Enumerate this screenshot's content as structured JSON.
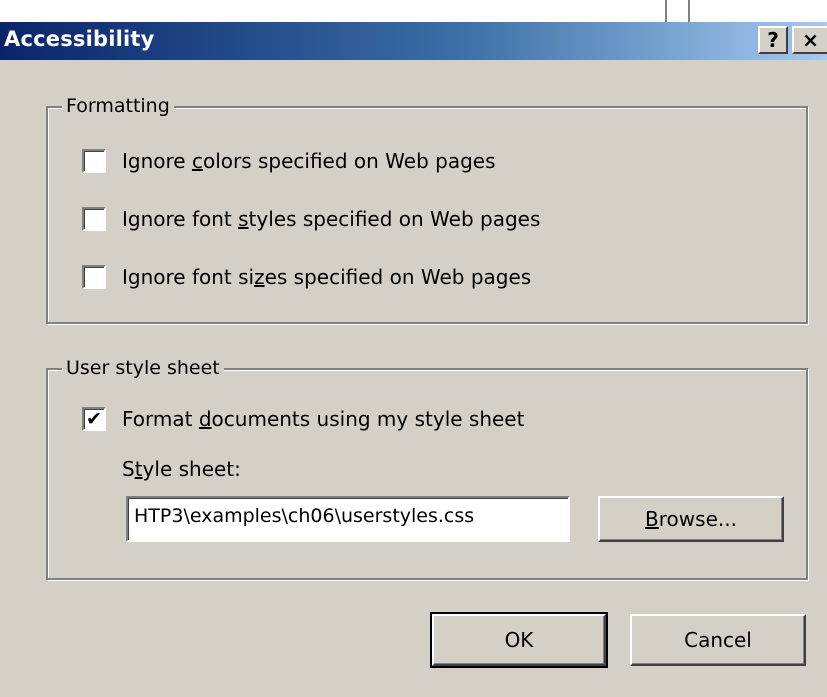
{
  "dialog": {
    "title": "Accessibility",
    "help_button": "?",
    "close_button": "×"
  },
  "formatting": {
    "label": "Formatting",
    "options": [
      {
        "pre": "Ignore ",
        "key": "c",
        "post": "olors specified on Web pages",
        "checked": false
      },
      {
        "pre": "Ignore font ",
        "key": "s",
        "post": "tyles specified on Web pages",
        "checked": false
      },
      {
        "pre": "Ignore font si",
        "key": "z",
        "post": "es specified on Web pages",
        "checked": false
      }
    ]
  },
  "user_style_sheet": {
    "label": "User style sheet",
    "format_option": {
      "pre": "Format ",
      "key": "d",
      "post": "ocuments using my style sheet",
      "checked": true
    },
    "style_sheet_label": {
      "pre": "S",
      "key": "t",
      "post": "yle sheet:"
    },
    "style_sheet_value": "HTP3\\examples\\ch06\\userstyles.css",
    "browse": {
      "key": "B",
      "post": "rowse..."
    }
  },
  "buttons": {
    "ok": "OK",
    "cancel": "Cancel"
  }
}
